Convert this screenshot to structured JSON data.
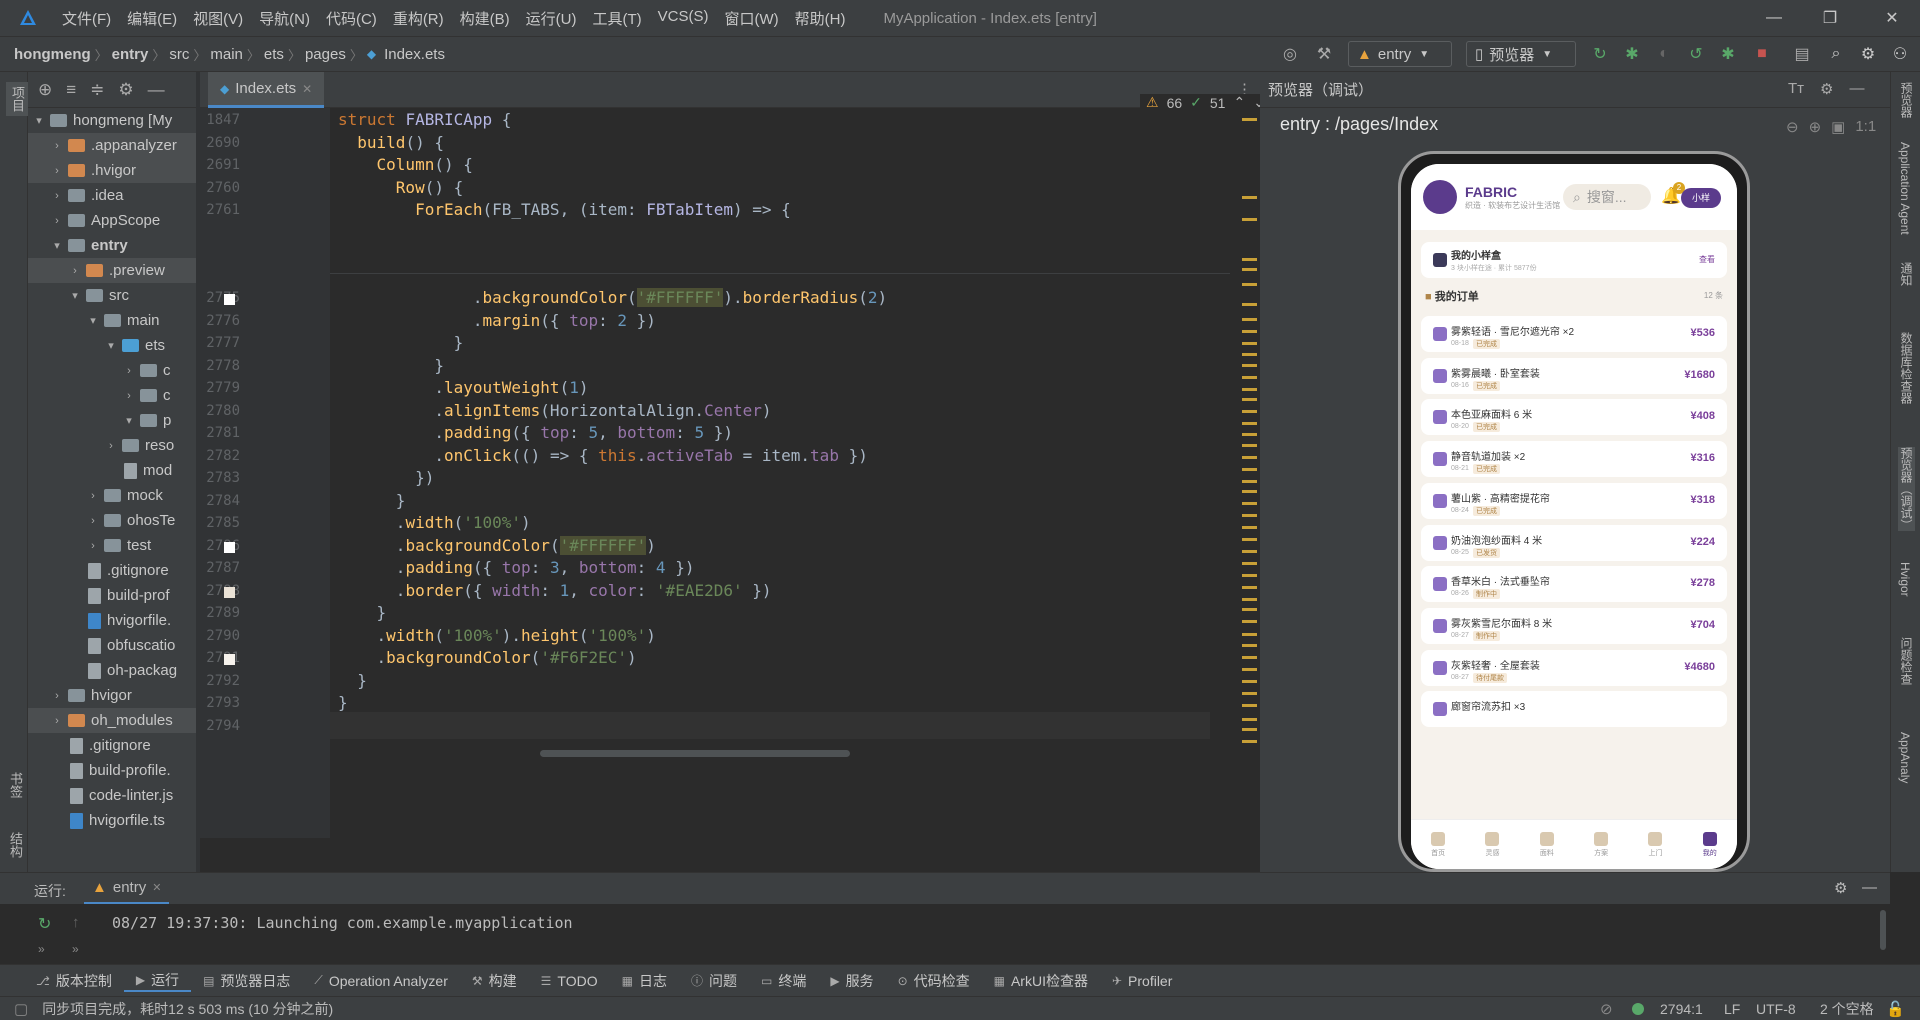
{
  "menubar": {
    "items": [
      "文件(F)",
      "编辑(E)",
      "视图(V)",
      "导航(N)",
      "代码(C)",
      "重构(R)",
      "构建(B)",
      "运行(U)",
      "工具(T)",
      "VCS(S)",
      "窗口(W)",
      "帮助(H)"
    ],
    "window_title": "MyApplication - Index.ets [entry]"
  },
  "breadcrumb": [
    "hongmeng",
    "entry",
    "src",
    "main",
    "ets",
    "pages",
    "Index.ets"
  ],
  "toolbar": {
    "run_config": "entry",
    "device": "预览器"
  },
  "project_tree": [
    {
      "label": "hongmeng [My",
      "depth": 0,
      "arrow": "v",
      "kind": "folder"
    },
    {
      "label": ".appanalyzer",
      "depth": 1,
      "arrow": ">",
      "kind": "folder-orange",
      "sel": true
    },
    {
      "label": ".hvigor",
      "depth": 1,
      "arrow": ">",
      "kind": "folder-orange",
      "sel": true
    },
    {
      "label": ".idea",
      "depth": 1,
      "arrow": ">",
      "kind": "folder"
    },
    {
      "label": "AppScope",
      "depth": 1,
      "arrow": ">",
      "kind": "folder"
    },
    {
      "label": "entry",
      "depth": 1,
      "arrow": "v",
      "kind": "folder",
      "bold": true
    },
    {
      "label": ".preview",
      "depth": 2,
      "arrow": ">",
      "kind": "folder-orange",
      "sel": true
    },
    {
      "label": "src",
      "depth": 2,
      "arrow": "v",
      "kind": "folder"
    },
    {
      "label": "main",
      "depth": 3,
      "arrow": "v",
      "kind": "folder"
    },
    {
      "label": "ets",
      "depth": 4,
      "arrow": "v",
      "kind": "folder-blue"
    },
    {
      "label": "c",
      "depth": 5,
      "arrow": ">",
      "kind": "folder"
    },
    {
      "label": "c",
      "depth": 5,
      "arrow": ">",
      "kind": "folder"
    },
    {
      "label": "p",
      "depth": 5,
      "arrow": "v",
      "kind": "folder"
    },
    {
      "label": "reso",
      "depth": 4,
      "arrow": ">",
      "kind": "folder"
    },
    {
      "label": "mod",
      "depth": 4,
      "arrow": "",
      "kind": "file"
    },
    {
      "label": "mock",
      "depth": 3,
      "arrow": ">",
      "kind": "folder"
    },
    {
      "label": "ohosTe",
      "depth": 3,
      "arrow": ">",
      "kind": "folder"
    },
    {
      "label": "test",
      "depth": 3,
      "arrow": ">",
      "kind": "folder"
    },
    {
      "label": ".gitignore",
      "depth": 2,
      "arrow": "",
      "kind": "file"
    },
    {
      "label": "build-prof",
      "depth": 2,
      "arrow": "",
      "kind": "file"
    },
    {
      "label": "hvigorfile.",
      "depth": 2,
      "arrow": "",
      "kind": "file-ts"
    },
    {
      "label": "obfuscatio",
      "depth": 2,
      "arrow": "",
      "kind": "file"
    },
    {
      "label": "oh-packag",
      "depth": 2,
      "arrow": "",
      "kind": "file"
    },
    {
      "label": "hvigor",
      "depth": 1,
      "arrow": ">",
      "kind": "folder"
    },
    {
      "label": "oh_modules",
      "depth": 1,
      "arrow": ">",
      "kind": "folder-orange",
      "sel": true
    },
    {
      "label": ".gitignore",
      "depth": 1,
      "arrow": "",
      "kind": "file"
    },
    {
      "label": "build-profile.",
      "depth": 1,
      "arrow": "",
      "kind": "file"
    },
    {
      "label": "code-linter.js",
      "depth": 1,
      "arrow": "",
      "kind": "file"
    },
    {
      "label": "hvigorfile.ts",
      "depth": 1,
      "arrow": "",
      "kind": "file-ts"
    }
  ],
  "editor": {
    "tab_label": "Index.ets",
    "warnings": "66",
    "weak_warnings": "51",
    "sticky": [
      {
        "ln": "1847",
        "html": "<span class=\"kw\">struct</span> <span class=\"tp\">FABRICApp</span> {"
      },
      {
        "ln": "2690",
        "html": "  <span class=\"fn\">build</span>() {"
      },
      {
        "ln": "2691",
        "html": "    <span class=\"fn\">Column</span>() {"
      },
      {
        "ln": "2760",
        "html": "      <span class=\"fn\">Row</span>() {"
      },
      {
        "ln": "2761",
        "html": "        <span class=\"fn\">ForEach</span>(FB_TABS, (item: <span class=\"tp\">FBTabItem</span>) => {"
      }
    ],
    "lines": [
      {
        "ln": "2775",
        "html": "              .<span class=\"fn\">backgroundColor</span>(<span class=\"str hl\">'#FFFFFF'</span>).<span class=\"fn\">borderRadius</span>(<span class=\"num\">2</span>)",
        "swatch": true
      },
      {
        "ln": "2776",
        "html": "              .<span class=\"fn\">margin</span>({ <span class=\"dot\">top</span>: <span class=\"num\">2</span> })"
      },
      {
        "ln": "2777",
        "html": "            }"
      },
      {
        "ln": "2778",
        "html": "          }"
      },
      {
        "ln": "2779",
        "html": "          .<span class=\"fn\">layoutWeight</span>(<span class=\"num\">1</span>)"
      },
      {
        "ln": "2780",
        "html": "          .<span class=\"fn\">alignItems</span>(HorizontalAlign.<span class=\"dot\">Center</span>)"
      },
      {
        "ln": "2781",
        "html": "          .<span class=\"fn\">padding</span>({ <span class=\"dot\">top</span>: <span class=\"num\">5</span>, <span class=\"dot\">bottom</span>: <span class=\"num\">5</span> })"
      },
      {
        "ln": "2782",
        "html": "          .<span class=\"fn\">onClick</span>(() => { <span class=\"kw\">this</span>.<span class=\"dot\">activeTab</span> = item.<span class=\"dot\">tab</span> })"
      },
      {
        "ln": "2783",
        "html": "        })"
      },
      {
        "ln": "2784",
        "html": "      }"
      },
      {
        "ln": "2785",
        "html": "      .<span class=\"fn\">width</span>(<span class=\"str\">'100%'</span>)"
      },
      {
        "ln": "2786",
        "html": "      .<span class=\"fn\">backgroundColor</span>(<span class=\"str hl\">'#FFFFFF'</span>)",
        "swatch": true
      },
      {
        "ln": "2787",
        "html": "      .<span class=\"fn\">padding</span>({ <span class=\"dot\">top</span>: <span class=\"num\">3</span>, <span class=\"dot\">bottom</span>: <span class=\"num\">4</span> })"
      },
      {
        "ln": "2788",
        "html": "      .<span class=\"fn\">border</span>({ <span class=\"dot\">width</span>: <span class=\"num\">1</span>, <span class=\"dot\">color</span>: <span class=\"str\">'#EAE2D6'</span> })",
        "swatch": true
      },
      {
        "ln": "2789",
        "html": "    }"
      },
      {
        "ln": "2790",
        "html": "    .<span class=\"fn\">width</span>(<span class=\"str\">'100%'</span>).<span class=\"fn\">height</span>(<span class=\"str\">'100%'</span>)"
      },
      {
        "ln": "2791",
        "html": "    .<span class=\"fn\">backgroundColor</span>(<span class=\"str\">'#F6F2EC'</span>)",
        "swatch": true
      },
      {
        "ln": "2792",
        "html": "  }"
      },
      {
        "ln": "2793",
        "html": "}"
      },
      {
        "ln": "2794",
        "html": ""
      }
    ]
  },
  "preview": {
    "title": "预览器（调试）",
    "path": "entry : /pages/Index",
    "app": {
      "brand": "FABRIC",
      "brand_sub": "织造 · 软装布艺设计生活馆",
      "search_placeholder": "搜窗...",
      "bell_badge": "2",
      "profile_btn": "小样",
      "sample_box_title": "我的小样盒",
      "sample_box_sub": "3 块小样在途 · 累计 5877份",
      "sample_box_action": "查看",
      "orders_title": "我的订单",
      "orders_count": "12 条",
      "orders": [
        {
          "name": "雾紫轻语 · 雪尼尔遮光帘 ×2",
          "date": "08-18",
          "tag": "已完成",
          "price": "¥536"
        },
        {
          "name": "紫雾晨曦 · 卧室套装",
          "date": "08-16",
          "tag": "已完成",
          "price": "¥1680"
        },
        {
          "name": "本色亚麻面料 6 米",
          "date": "08-20",
          "tag": "已完成",
          "price": "¥408"
        },
        {
          "name": "静音轨道加装 ×2",
          "date": "08-21",
          "tag": "已完成",
          "price": "¥316"
        },
        {
          "name": "薯山紫 · 高精密提花帘",
          "date": "08-24",
          "tag": "已完成",
          "price": "¥318"
        },
        {
          "name": "奶油泡泡纱面料 4 米",
          "date": "08-25",
          "tag": "已发货",
          "price": "¥224"
        },
        {
          "name": "香草米白 · 法式垂坠帘",
          "date": "08-26",
          "tag": "制作中",
          "price": "¥278"
        },
        {
          "name": "雾灰紫雪尼尔面料 8 米",
          "date": "08-27",
          "tag": "制作中",
          "price": "¥704"
        },
        {
          "name": "灰紫轻奢 · 全屋套装",
          "date": "08-27",
          "tag": "待付尾款",
          "price": "¥4680"
        },
        {
          "name": "廊窗帘流苏扣 ×3",
          "date": "",
          "tag": "",
          "price": ""
        }
      ],
      "nav": [
        "首页",
        "灵感",
        "面料",
        "方案",
        "上门",
        "我的"
      ]
    }
  },
  "right_strip": [
    "预览器",
    "Application Agent",
    "通知",
    "数据库检查器",
    "预览器（调试）",
    "Hvigor",
    "问题检查",
    "AppAnaly"
  ],
  "left_strip": [
    "项目",
    "书签",
    "结构"
  ],
  "run": {
    "label": "运行:",
    "tab": "entry",
    "log": "08/27 19:37:30: Launching com.example.myapplication"
  },
  "toolwindows": [
    "版本控制",
    "运行",
    "预览器日志",
    "Operation Analyzer",
    "构建",
    "TODO",
    "日志",
    "问题",
    "终端",
    "服务",
    "代码检查",
    "ArkUI检查器",
    "Profiler"
  ],
  "status": {
    "message": "同步项目完成，耗时12 s 503 ms (10 分钟之前)",
    "position": "2794:1",
    "line_sep": "LF",
    "encoding": "UTF-8",
    "indent": "2 个空格"
  }
}
